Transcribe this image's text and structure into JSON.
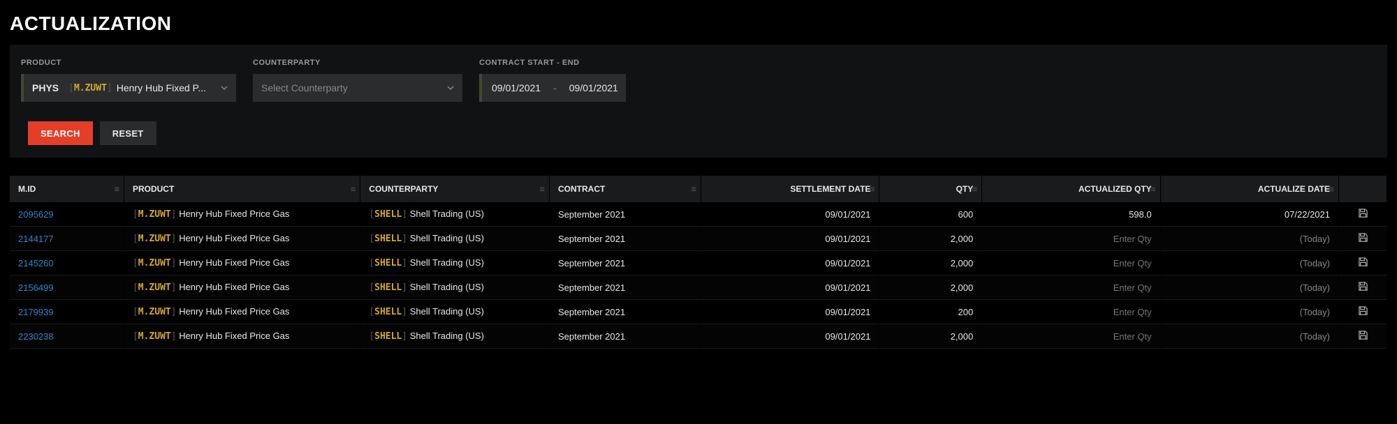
{
  "title": "ACTUALIZATION",
  "filters": {
    "product_label": "PRODUCT",
    "counterparty_label": "COUNTERPARTY",
    "daterange_label": "CONTRACT START - END",
    "product": {
      "type": "PHYS",
      "ticker": "M.ZUWT",
      "name": "Henry Hub Fixed P..."
    },
    "counterparty_placeholder": "Select Counterparty",
    "start_date": "09/01/2021",
    "end_date": "09/01/2021"
  },
  "buttons": {
    "search": "SEARCH",
    "reset": "RESET"
  },
  "columns": {
    "mid": "M.ID",
    "product": "PRODUCT",
    "counterparty": "COUNTERPARTY",
    "contract": "CONTRACT",
    "settlement": "SETTLEMENT DATE",
    "qty": "QTY",
    "actualized_qty": "ACTUALIZED QTY",
    "actualize_date": "ACTUALIZE DATE"
  },
  "placeholders": {
    "enter_qty": "Enter Qty",
    "today": "(Today)"
  },
  "rows": [
    {
      "mid": "2095629",
      "prod_ticker": "M.ZUWT",
      "prod_name": "Henry Hub Fixed Price Gas",
      "cp_ticker": "SHELL",
      "cp_name": "Shell Trading (US)",
      "contract": "September 2021",
      "settlement": "09/01/2021",
      "qty": "600",
      "aqty": "598.0",
      "adate": "07/22/2021"
    },
    {
      "mid": "2144177",
      "prod_ticker": "M.ZUWT",
      "prod_name": "Henry Hub Fixed Price Gas",
      "cp_ticker": "SHELL",
      "cp_name": "Shell Trading (US)",
      "contract": "September 2021",
      "settlement": "09/01/2021",
      "qty": "2,000",
      "aqty": "",
      "adate": ""
    },
    {
      "mid": "2145260",
      "prod_ticker": "M.ZUWT",
      "prod_name": "Henry Hub Fixed Price Gas",
      "cp_ticker": "SHELL",
      "cp_name": "Shell Trading (US)",
      "contract": "September 2021",
      "settlement": "09/01/2021",
      "qty": "2,000",
      "aqty": "",
      "adate": ""
    },
    {
      "mid": "2156499",
      "prod_ticker": "M.ZUWT",
      "prod_name": "Henry Hub Fixed Price Gas",
      "cp_ticker": "SHELL",
      "cp_name": "Shell Trading (US)",
      "contract": "September 2021",
      "settlement": "09/01/2021",
      "qty": "2,000",
      "aqty": "",
      "adate": ""
    },
    {
      "mid": "2179939",
      "prod_ticker": "M.ZUWT",
      "prod_name": "Henry Hub Fixed Price Gas",
      "cp_ticker": "SHELL",
      "cp_name": "Shell Trading (US)",
      "contract": "September 2021",
      "settlement": "09/01/2021",
      "qty": "200",
      "aqty": "",
      "adate": ""
    },
    {
      "mid": "2230238",
      "prod_ticker": "M.ZUWT",
      "prod_name": "Henry Hub Fixed Price Gas",
      "cp_ticker": "SHELL",
      "cp_name": "Shell Trading (US)",
      "contract": "September 2021",
      "settlement": "09/01/2021",
      "qty": "2,000",
      "aqty": "",
      "adate": ""
    }
  ]
}
